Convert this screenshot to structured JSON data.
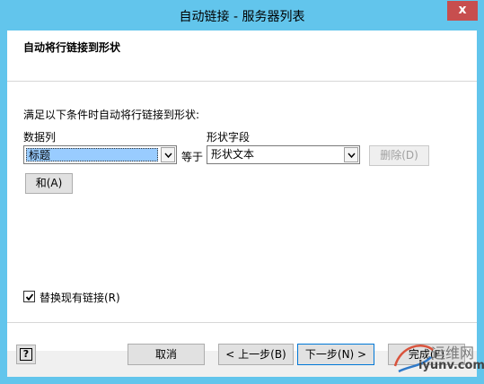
{
  "window": {
    "title": "自动链接 - 服务器列表",
    "close_glyph": "x"
  },
  "header": {
    "title": "自动将行链接到形状"
  },
  "main": {
    "instruction": "满足以下条件时自动将行链接到形状:",
    "data_column_label": "数据列",
    "shape_field_label": "形状字段",
    "data_column_value": "标题",
    "equals_label": "等于",
    "shape_field_value": "形状文本",
    "delete_label": "删除(D)",
    "and_label": "和(A)"
  },
  "options": {
    "replace_links_label": "替换现有链接(R)",
    "replace_links_checked": true
  },
  "footer": {
    "help_glyph": "?",
    "cancel_label": "取消",
    "back_label": "< 上一步(B)",
    "next_label": "下一步(N) >",
    "finish_label": "完成(F)"
  },
  "watermark": {
    "brand": "运维网",
    "domain": "iyunv.com"
  },
  "colors": {
    "frame": "#62c5ec",
    "close": "#c74e4e",
    "selection": "#99ccff"
  },
  "icons": {
    "dropdown": "chevron-down-icon",
    "checkbox": "check-icon",
    "help": "help-icon"
  }
}
